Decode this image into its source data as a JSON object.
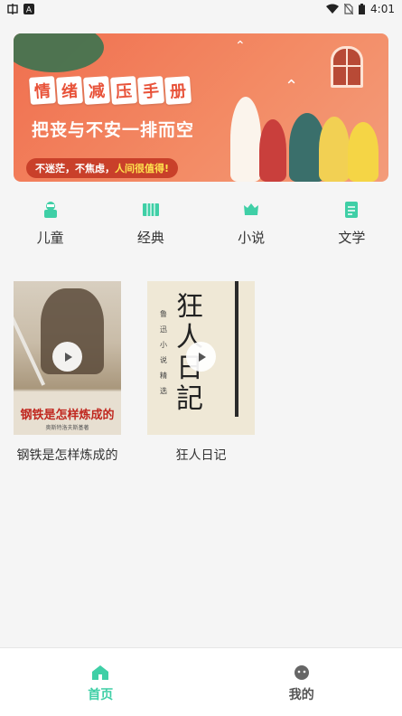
{
  "status_bar": {
    "time": "4:01",
    "left_icons": [
      "app-notification-icon",
      "font-icon"
    ],
    "right_icons": [
      "wifi-icon",
      "no-sim-icon",
      "battery-icon"
    ]
  },
  "banner": {
    "title_chars": [
      "情",
      "绪",
      "减",
      "压",
      "手",
      "册"
    ],
    "subtitle": "把丧与不安一排而空",
    "tag_prefix": "不迷茫，不焦虑，",
    "tag_highlight": "人间很值得!"
  },
  "categories": [
    {
      "label": "儿童",
      "icon": "child-icon"
    },
    {
      "label": "经典",
      "icon": "classic-books-icon"
    },
    {
      "label": "小说",
      "icon": "novel-icon"
    },
    {
      "label": "文学",
      "icon": "literature-icon"
    }
  ],
  "books": [
    {
      "title": "钢铁是怎样炼成的",
      "cover_title": "钢铁是怎样炼成的",
      "cover_sub": "奥斯特洛夫斯基著"
    },
    {
      "title": "狂人日记",
      "cover_callig": "狂人日記",
      "cover_vert": "鲁迅小说精选"
    }
  ],
  "bottom_nav": [
    {
      "label": "首页",
      "icon": "home-icon",
      "active": true
    },
    {
      "label": "我的",
      "icon": "profile-icon",
      "active": false
    }
  ],
  "colors": {
    "accent": "#3fcfa6",
    "banner_bg": "#f06f4f",
    "background": "#f5f5f5"
  }
}
